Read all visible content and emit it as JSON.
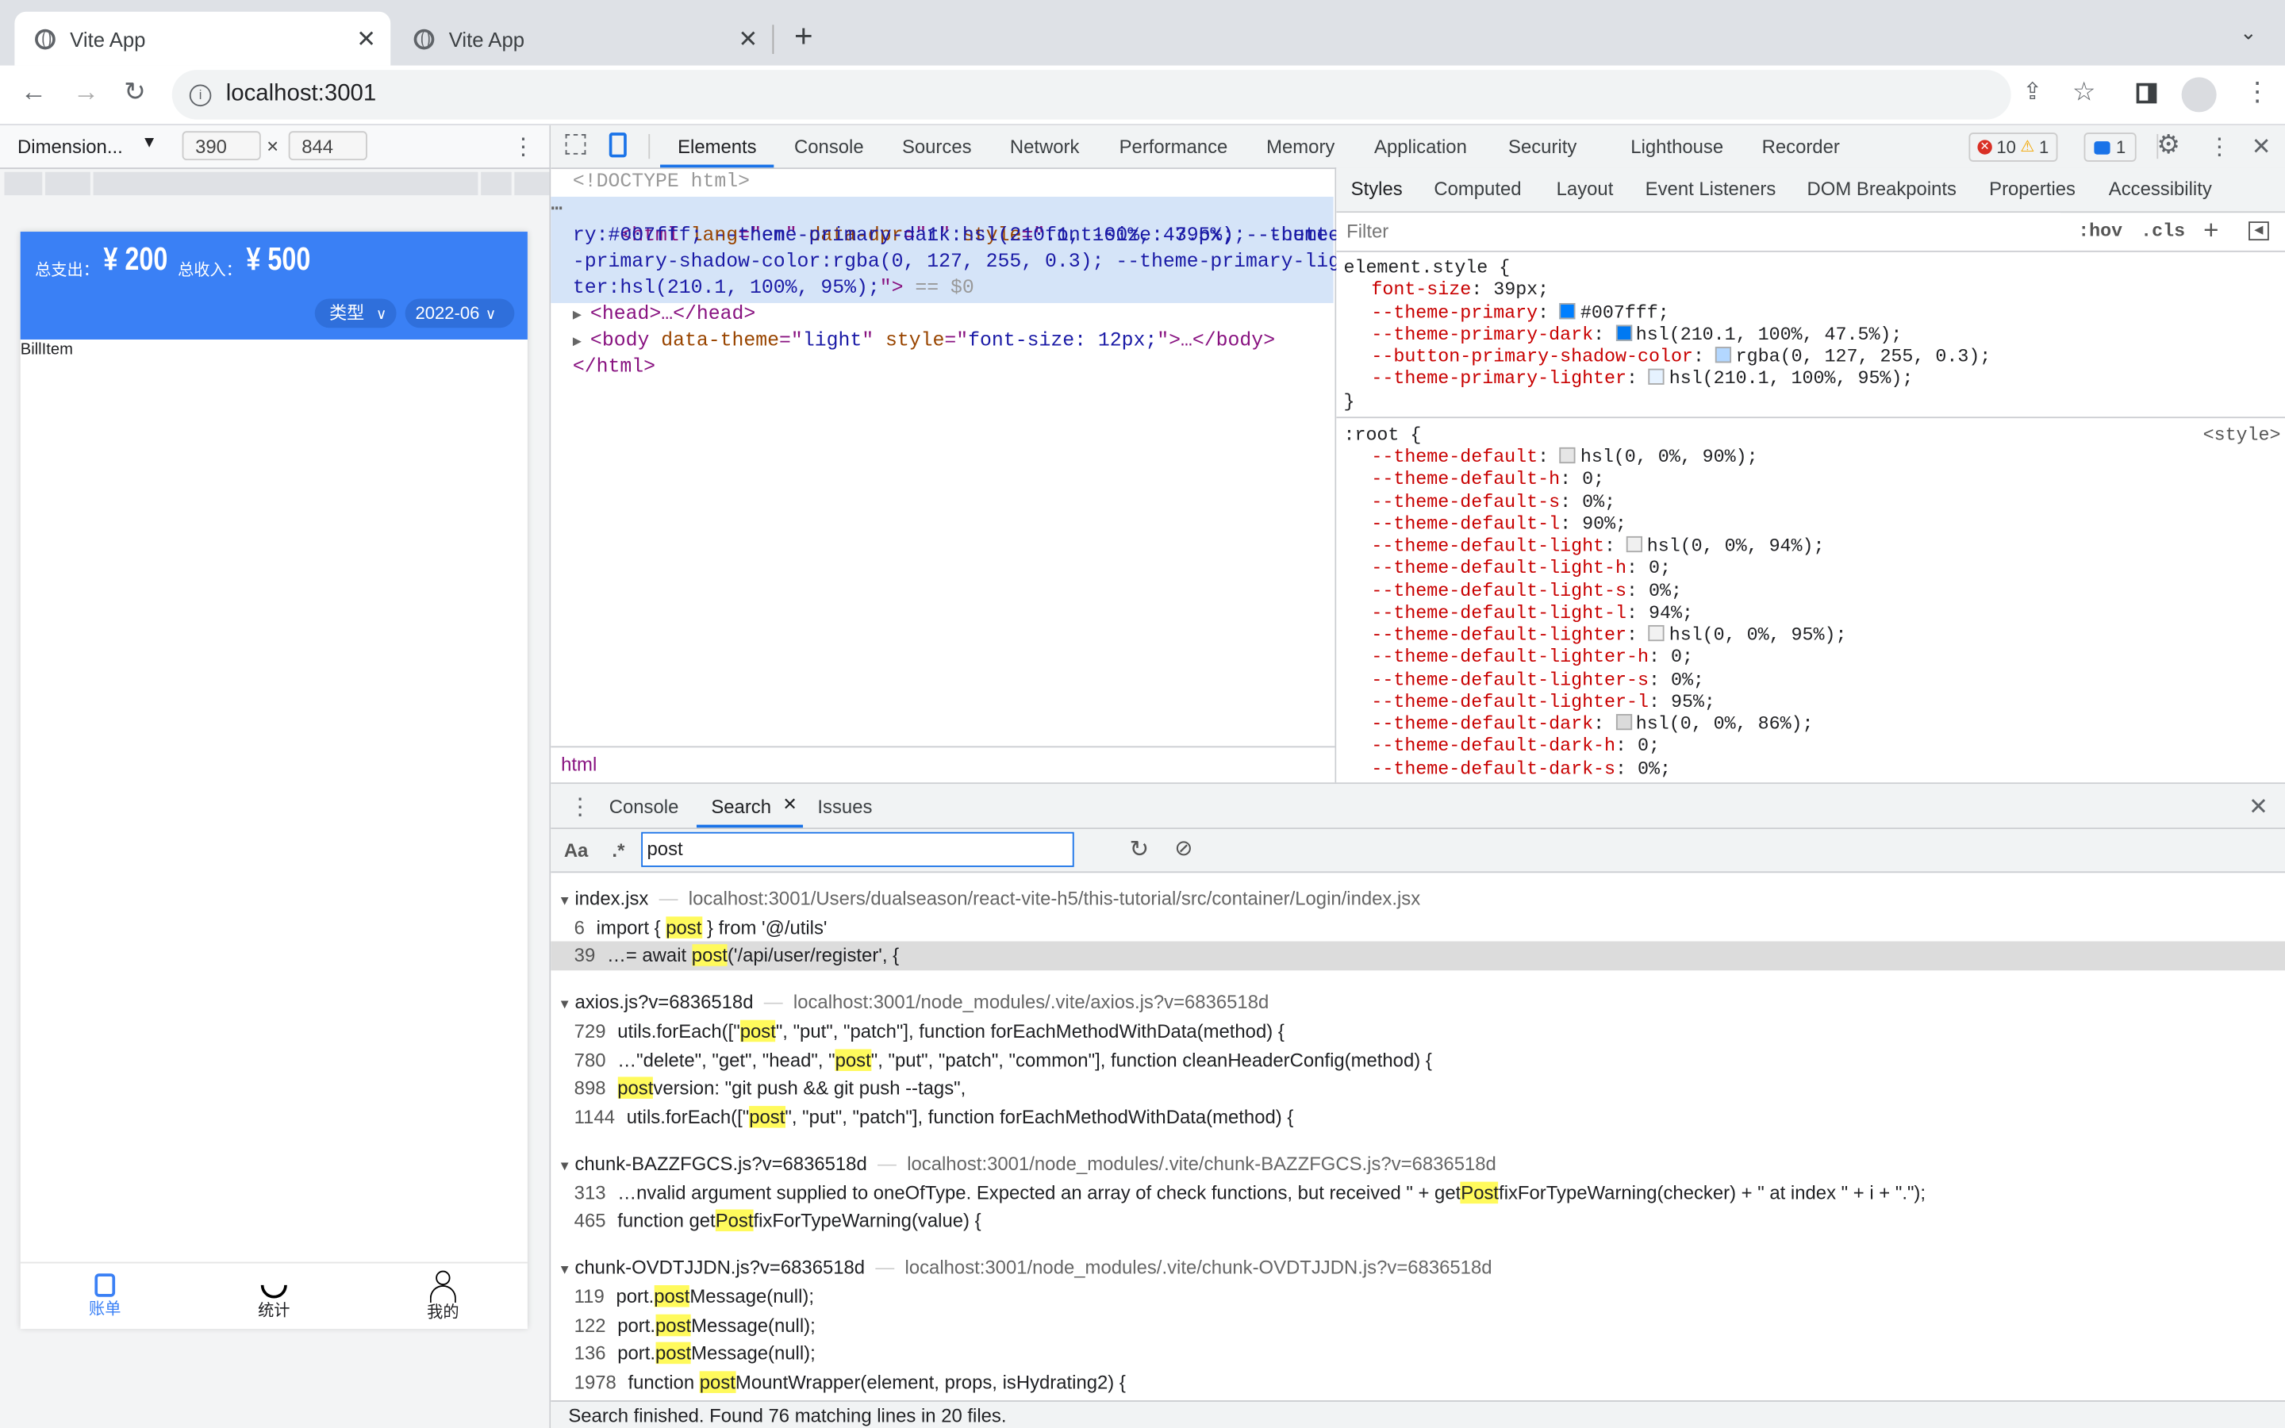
{
  "browser": {
    "tabs": [
      {
        "title": "Vite App",
        "active": true
      },
      {
        "title": "Vite App",
        "active": false
      }
    ],
    "url": "localhost:3001"
  },
  "device_toolbar": {
    "preset": "Dimension...",
    "width": "390",
    "height": "844",
    "times": "×"
  },
  "app": {
    "accent": "#3a80f5",
    "expense_label": "总支出：",
    "expense_value": "¥ 200",
    "income_label": "总收入：",
    "income_value": "¥ 500",
    "type_filter": "类型",
    "date_filter": "2022-06",
    "bill_item": "BillItem",
    "nav": [
      {
        "label": "账单",
        "icon": "bill-icon",
        "active": true
      },
      {
        "label": "统计",
        "icon": "pie-chart-icon",
        "active": false
      },
      {
        "label": "我的",
        "icon": "user-icon",
        "active": false
      }
    ]
  },
  "devtools": {
    "tabs": [
      "Elements",
      "Console",
      "Sources",
      "Network",
      "Performance",
      "Memory",
      "Application",
      "Security",
      "Lighthouse",
      "Recorder"
    ],
    "active_tab": "Elements",
    "errors": "10",
    "warnings": "1",
    "messages": "1",
    "elements": {
      "doctype": "<!DOCTYPE html>",
      "html_open": [
        "<html",
        " lang",
        "=\"",
        "en",
        "\"",
        " data-dpr",
        "=\"",
        "1",
        "\"",
        " style",
        "=\"",
        "font-size: 39px; --theme-prima"
      ],
      "html_wrap": [
        "ry:#007fff; --theme-primary-dark:hsl(210.1, 100%, 47.5%); --button",
        "-primary-shadow-color:rgba(0, 127, 255, 0.3); --theme-primary-ligh",
        "ter:hsl(210.1, 100%, 95%);"
      ],
      "html_close": "\">",
      "selected_marker": " == $0",
      "head": "<head>…</head>",
      "body_tag": "<body",
      "body_attr1": " data-theme",
      "body_val1": "light",
      "body_attr2": " style",
      "body_val2": "font-size: 12px;",
      "body_end": ">…</body>",
      "html_end": "</html>",
      "breadcrumb": "html"
    },
    "styles": {
      "tabs": [
        "Styles",
        "Computed",
        "Layout",
        "Event Listeners",
        "DOM Breakpoints",
        "Properties",
        "Accessibility"
      ],
      "filter_placeholder": "Filter",
      "hov": ":hov",
      "cls": ".cls",
      "plus": "+",
      "element_selector": "element.style {",
      "element_props": [
        {
          "name": "font-size",
          "value": "39px;"
        },
        {
          "name": "--theme-primary",
          "value": "#007fff;",
          "swatch": "#007fff"
        },
        {
          "name": "--theme-primary-dark",
          "value": "hsl(210.1, 100%, 47.5%);",
          "swatch": "#0079f2"
        },
        {
          "name": "--button-primary-shadow-color",
          "value": "rgba(0, 127, 255, 0.3);",
          "swatch": "#b3d7ff"
        },
        {
          "name": "--theme-primary-lighter",
          "value": "hsl(210.1, 100%, 95%);",
          "swatch": "#e6f2ff"
        }
      ],
      "close_brace": "}",
      "root_selector": ":root {",
      "root_source": "<style>",
      "root_props": [
        {
          "name": "--theme-default",
          "value": "hsl(0, 0%, 90%);",
          "swatch": "#e6e6e6"
        },
        {
          "name": "--theme-default-h",
          "value": "0;"
        },
        {
          "name": "--theme-default-s",
          "value": "0%;"
        },
        {
          "name": "--theme-default-l",
          "value": "90%;"
        },
        {
          "name": "--theme-default-light",
          "value": "hsl(0, 0%, 94%);",
          "swatch": "#f0f0f0"
        },
        {
          "name": "--theme-default-light-h",
          "value": "0;"
        },
        {
          "name": "--theme-default-light-s",
          "value": "0%;"
        },
        {
          "name": "--theme-default-light-l",
          "value": "94%;"
        },
        {
          "name": "--theme-default-lighter",
          "value": "hsl(0, 0%, 95%);",
          "swatch": "#f2f2f2"
        },
        {
          "name": "--theme-default-lighter-h",
          "value": "0;"
        },
        {
          "name": "--theme-default-lighter-s",
          "value": "0%;"
        },
        {
          "name": "--theme-default-lighter-l",
          "value": "95%;"
        },
        {
          "name": "--theme-default-dark",
          "value": "hsl(0, 0%, 86%);",
          "swatch": "#dbdbdb"
        },
        {
          "name": "--theme-default-dark-h",
          "value": "0;"
        },
        {
          "name": "--theme-default-dark-s",
          "value": "0%;"
        }
      ]
    },
    "drawer": {
      "tabs": [
        "Console",
        "Search",
        "Issues"
      ],
      "active_tab": "Search",
      "case_toggle": "Aa",
      "regex_toggle": ".*",
      "query": "post",
      "groups": [
        {
          "file": "index.jsx",
          "path": "localhost:3001/Users/dualseason/react-vite-h5/this-tutorial/src/container/Login/index.jsx",
          "lines": [
            {
              "num": "6",
              "pre": "import { ",
              "match": "post",
              "post": " } from '@/utils'"
            },
            {
              "num": "39",
              "pre": "…= await ",
              "match": "post",
              "post": "('/api/user/register', {",
              "selected": true
            }
          ]
        },
        {
          "file": "axios.js?v=6836518d",
          "path": "localhost:3001/node_modules/.vite/axios.js?v=6836518d",
          "lines": [
            {
              "num": "729",
              "pre": "utils.forEach([\"",
              "match": "post",
              "post": "\", \"put\", \"patch\"], function forEachMethodWithData(method) {"
            },
            {
              "num": "780",
              "pre": "…\"delete\", \"get\", \"head\", \"",
              "match": "post",
              "post": "\", \"put\", \"patch\", \"common\"], function cleanHeaderConfig(method) {"
            },
            {
              "num": "898",
              "pre": "",
              "match": "post",
              "post": "version: \"git push && git push --tags\","
            },
            {
              "num": "1144",
              "pre": "utils.forEach([\"",
              "match": "post",
              "post": "\", \"put\", \"patch\"], function forEachMethodWithData(method) {"
            }
          ]
        },
        {
          "file": "chunk-BAZZFGCS.js?v=6836518d",
          "path": "localhost:3001/node_modules/.vite/chunk-BAZZFGCS.js?v=6836518d",
          "lines": [
            {
              "num": "313",
              "pre": "…nvalid argument supplied to oneOfType. Expected an array of check functions, but received \" + get",
              "match": "Post",
              "post": "fixForTypeWarning(checker) + \" at index \" + i + \".\");"
            },
            {
              "num": "465",
              "pre": "function get",
              "match": "Post",
              "post": "fixForTypeWarning(value) {"
            }
          ]
        },
        {
          "file": "chunk-OVDTJJDN.js?v=6836518d",
          "path": "localhost:3001/node_modules/.vite/chunk-OVDTJJDN.js?v=6836518d",
          "lines": [
            {
              "num": "119",
              "pre": "port.",
              "match": "post",
              "post": "Message(null);"
            },
            {
              "num": "122",
              "pre": "port.",
              "match": "post",
              "post": "Message(null);"
            },
            {
              "num": "136",
              "pre": "port.",
              "match": "post",
              "post": "Message(null);"
            },
            {
              "num": "1978",
              "pre": "function ",
              "match": "post",
              "post": "MountWrapper(element, props, isHydrating2) {"
            }
          ]
        }
      ],
      "status": "Search finished.  Found 76 matching lines in 20 files."
    }
  }
}
